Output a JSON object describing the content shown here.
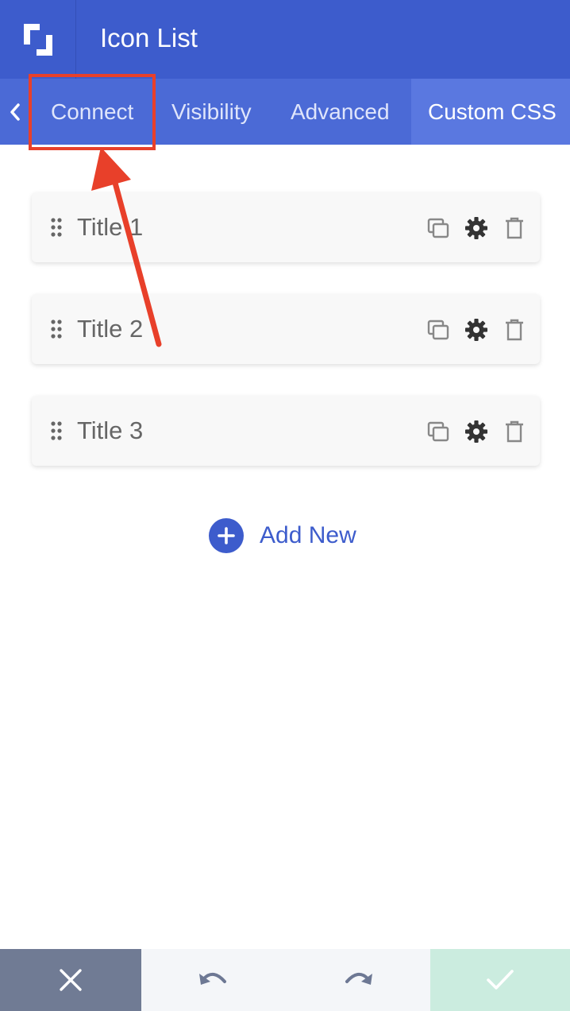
{
  "header": {
    "title": "Icon List"
  },
  "tabs": [
    {
      "label": "Connect",
      "active": false
    },
    {
      "label": "Visibility",
      "active": false
    },
    {
      "label": "Advanced",
      "active": false
    },
    {
      "label": "Custom CSS",
      "active": true
    }
  ],
  "items": [
    {
      "label": "Title 1"
    },
    {
      "label": "Title 2"
    },
    {
      "label": "Title 3"
    }
  ],
  "add_new": {
    "label": "Add New"
  },
  "icons": {
    "logo": "logo-icon",
    "back": "chevron-left-icon",
    "drag": "drag-handle-icon",
    "copy": "copy-icon",
    "settings": "gear-icon",
    "delete": "trash-icon",
    "add": "plus-circle-icon",
    "cancel": "close-icon",
    "undo": "undo-icon",
    "redo": "redo-icon",
    "save": "check-icon"
  },
  "colors": {
    "primary": "#3d5ccc",
    "annotation": "#e8402a",
    "cancel_bg": "#707b94",
    "save_bg": "#cbecdf"
  }
}
